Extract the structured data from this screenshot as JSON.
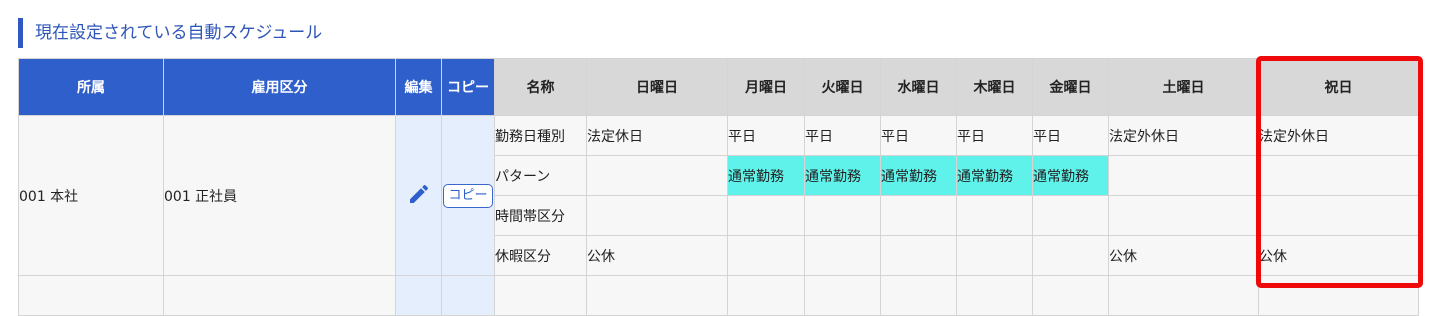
{
  "section": {
    "title": "現在設定されている自動スケジュール"
  },
  "headers": {
    "affiliation": "所属",
    "employment": "雇用区分",
    "edit": "編集",
    "copy": "コピー",
    "name": "名称",
    "sun": "日曜日",
    "mon": "月曜日",
    "tue": "火曜日",
    "wed": "水曜日",
    "thu": "木曜日",
    "fri": "金曜日",
    "sat": "土曜日",
    "holiday": "祝日"
  },
  "record": {
    "affiliation": "001 本社",
    "employment": "001 正社員",
    "copy_label": "コピー",
    "rows": [
      {
        "name": "勤務日種別",
        "sun": "法定休日",
        "mon": "平日",
        "tue": "平日",
        "wed": "平日",
        "thu": "平日",
        "fri": "平日",
        "sat": "法定外休日",
        "holiday": "法定外休日"
      },
      {
        "name": "パターン",
        "sun": "",
        "mon": "通常勤務",
        "tue": "通常勤務",
        "wed": "通常勤務",
        "thu": "通常勤務",
        "fri": "通常勤務",
        "sat": "",
        "holiday": ""
      },
      {
        "name": "時間帯区分",
        "sun": "",
        "mon": "",
        "tue": "",
        "wed": "",
        "thu": "",
        "fri": "",
        "sat": "",
        "holiday": ""
      },
      {
        "name": "休暇区分",
        "sun": "公休",
        "mon": "",
        "tue": "",
        "wed": "",
        "thu": "",
        "fri": "",
        "sat": "公休",
        "holiday": "公休"
      }
    ]
  },
  "colors": {
    "header_blue": "#2e5fcb",
    "pattern_cell": "#5ff2ea",
    "highlight_frame": "#ee0a0a"
  },
  "icons": {
    "edit": "pencil-icon"
  }
}
